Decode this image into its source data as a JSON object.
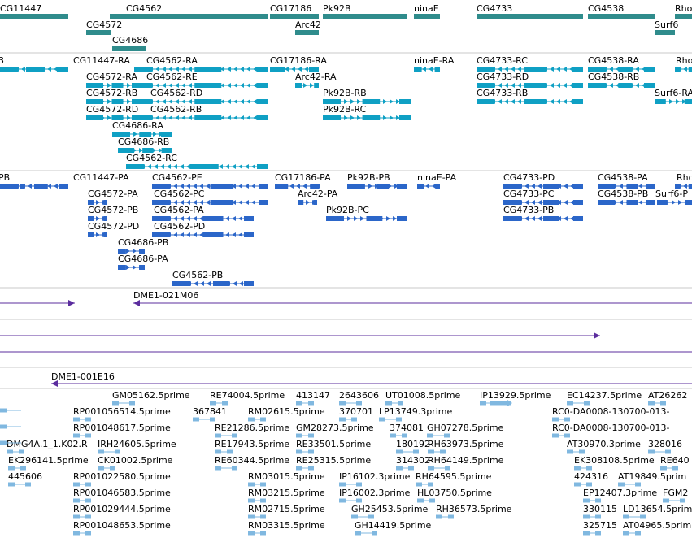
{
  "colors": {
    "gene": "#2f8c8c",
    "transcript": "#0fa0c4",
    "protein": "#2b66c9",
    "clone": "#5b2d9e",
    "est": "#80b8e0",
    "divider": "#c8c8c8",
    "text": "#000000"
  },
  "tracks": {
    "genes": [
      {
        "label": "CG11447"
      },
      {
        "label": "CG4562"
      },
      {
        "label": "CG4572"
      },
      {
        "label": "CG4686"
      },
      {
        "label": "CG17186"
      },
      {
        "label": "Pk92B"
      },
      {
        "label": "ninaE"
      },
      {
        "label": "Arc42"
      },
      {
        "label": "CG4733"
      },
      {
        "label": "CG4538"
      },
      {
        "label": "Surf6"
      },
      {
        "label": "Rho"
      }
    ],
    "transcripts": [
      {
        "label": "3"
      },
      {
        "label": "CG11447-RA"
      },
      {
        "label": "CG4562-RA"
      },
      {
        "label": "CG4572-RA"
      },
      {
        "label": "CG4562-RE"
      },
      {
        "label": "CG4572-RB"
      },
      {
        "label": "CG4562-RD"
      },
      {
        "label": "CG4572-RD"
      },
      {
        "label": "CG4562-RB"
      },
      {
        "label": "CG4686-RA"
      },
      {
        "label": "CG4686-RB"
      },
      {
        "label": "CG4562-RC"
      },
      {
        "label": "CG17186-RA"
      },
      {
        "label": "Arc42-RA"
      },
      {
        "label": "Pk92B-RB"
      },
      {
        "label": "Pk92B-RC"
      },
      {
        "label": "ninaE-RA"
      },
      {
        "label": "CG4733-RC"
      },
      {
        "label": "CG4733-RD"
      },
      {
        "label": "CG4733-RB"
      },
      {
        "label": "CG4538-RA"
      },
      {
        "label": "CG4538-RB"
      },
      {
        "label": "Surf6-RA"
      },
      {
        "label": "Rho"
      }
    ],
    "proteins": [
      {
        "label": "PB"
      },
      {
        "label": "CG11447-PA"
      },
      {
        "label": "CG4562-PE"
      },
      {
        "label": "CG4572-PA"
      },
      {
        "label": "CG4562-PC"
      },
      {
        "label": "CG4572-PB"
      },
      {
        "label": "CG4562-PA"
      },
      {
        "label": "CG4572-PD"
      },
      {
        "label": "CG4562-PD"
      },
      {
        "label": "CG4686-PB"
      },
      {
        "label": "CG4686-PA"
      },
      {
        "label": "CG4562-PB"
      },
      {
        "label": "CG17186-PA"
      },
      {
        "label": "Pk92B-PB"
      },
      {
        "label": "Arc42-PA"
      },
      {
        "label": "Pk92B-PC"
      },
      {
        "label": "ninaE-PA"
      },
      {
        "label": "CG4733-PD"
      },
      {
        "label": "CG4733-PC"
      },
      {
        "label": "CG4733-PB"
      },
      {
        "label": "CG4538-PA"
      },
      {
        "label": "CG4538-PB"
      },
      {
        "label": "Surf6-P"
      },
      {
        "label": "Rho"
      }
    ],
    "clones": [
      {
        "label": "DME1-021M06"
      },
      {
        "label": "DME1-001E16"
      }
    ],
    "ests": [
      {
        "label": "GM05162.5prime"
      },
      {
        "label": "RE74004.5prime"
      },
      {
        "label": "413147"
      },
      {
        "label": "2643606"
      },
      {
        "label": "UT01008.5prime"
      },
      {
        "label": "IP13929.5prime"
      },
      {
        "label": "EC14237.5prime"
      },
      {
        "label": "AT26262"
      },
      {
        "label": "RP001056514.5prime"
      },
      {
        "label": "367841"
      },
      {
        "label": "RM02615.5prime"
      },
      {
        "label": "370701"
      },
      {
        "label": "LP13749.3prime"
      },
      {
        "label": "RC0-DA0008-130700-013-"
      },
      {
        "label": "RP001048617.5prime"
      },
      {
        "label": "RE21286.5prime"
      },
      {
        "label": "GM28273.5prime"
      },
      {
        "label": "374081"
      },
      {
        "label": "GH07278.5prime"
      },
      {
        "label": "RC0-DA0008-130700-013-"
      },
      {
        "label": "DMG4A.1_1.K02.R"
      },
      {
        "label": "IRH24605.5prime"
      },
      {
        "label": "RE17943.5prime"
      },
      {
        "label": "RE33501.5prime"
      },
      {
        "label": "180192"
      },
      {
        "label": "RH63973.5prime"
      },
      {
        "label": "AT30970.3prime"
      },
      {
        "label": "328016"
      },
      {
        "label": "EK296141.5prime"
      },
      {
        "label": "CK01002.5prime"
      },
      {
        "label": "RE60344.5prime"
      },
      {
        "label": "RE25315.5prime"
      },
      {
        "label": "314302"
      },
      {
        "label": "RH64149.5prime"
      },
      {
        "label": "EK308108.5prime"
      },
      {
        "label": "RE640"
      },
      {
        "label": "445606"
      },
      {
        "label": "RP001022580.5prime"
      },
      {
        "label": "RM03015.5prime"
      },
      {
        "label": "IP16102.3prime"
      },
      {
        "label": "RH64595.5prime"
      },
      {
        "label": "424316"
      },
      {
        "label": "AT19849.5prim"
      },
      {
        "label": "RP001046583.5prime"
      },
      {
        "label": "RM03215.5prime"
      },
      {
        "label": "IP16002.3prime"
      },
      {
        "label": "HL03750.5prime"
      },
      {
        "label": "EP12407.3prime"
      },
      {
        "label": "FGM2"
      },
      {
        "label": "RP001029444.5prime"
      },
      {
        "label": "RM02715.5prime"
      },
      {
        "label": "GH25453.5prime"
      },
      {
        "label": "RH36573.5prime"
      },
      {
        "label": "330115"
      },
      {
        "label": "LD13654.5prim"
      },
      {
        "label": "RP001048653.5prime"
      },
      {
        "label": "RM03315.5prime"
      },
      {
        "label": "GH14419.5prime"
      },
      {
        "label": "325715"
      },
      {
        "label": "AT04965.5prim"
      }
    ]
  }
}
